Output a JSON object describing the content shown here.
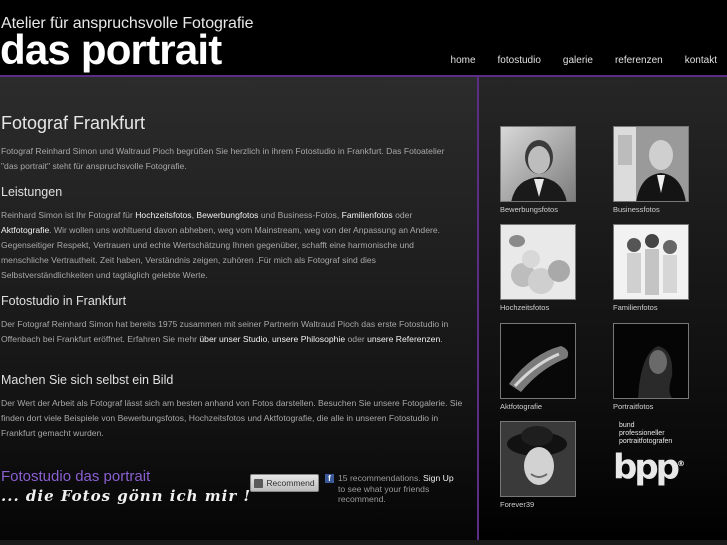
{
  "header": {
    "tagline": "Atelier für anspruchsvolle Fotografie",
    "brand": "das portrait"
  },
  "nav": [
    {
      "label": "home"
    },
    {
      "label": "fotostudio"
    },
    {
      "label": "galerie"
    },
    {
      "label": "referenzen"
    },
    {
      "label": "kontakt"
    }
  ],
  "main": {
    "title": "Fotograf Frankfurt",
    "intro": "Fotograf Reinhard Simon und Waltraud Pioch begrüßen Sie herzlich in ihrem Fotostudio in Frankfurt. Das Fotoatelier \"das portrait\" steht für anspruchsvolle Fotografie.",
    "leistungen_title": "Leistungen",
    "leistungen": {
      "t1": "Reinhard Simon ist Ihr Fotograf für ",
      "l1": "Hochzeitsfotos",
      "t2": ", ",
      "l2": "Bewerbungfotos",
      "t3": " und Business-Fotos, ",
      "l3": "Familienfotos",
      "t4": " oder ",
      "l4": "Aktfotografie",
      "t5": ". Wir wollen uns wohltuend davon abheben, weg vom Mainstream, weg von der Anpassung an Andere. Gegenseitiger Respekt, Vertrauen und echte Wertschätzung Ihnen gegenüber, schafft eine harmonische und menschliche Vertrautheit. Zeit haben, Verständnis zeigen, zuhören .Für mich als Fotograf sind dies Selbstverständlichkeiten und tagtäglich gelebte Werte."
    },
    "studio_title": "Fotostudio in Frankfurt",
    "studio": {
      "t1": "Der Fotograf Reinhard Simon hat bereits 1975 zusammen mit seiner Partnerin Waltraud Pioch das erste Fotostudio in Offenbach bei Frankfurt eröffnet. Erfahren Sie mehr ",
      "l1": "über unser Studio",
      "t2": ", ",
      "l2": "unsere Philosophie",
      "t3": " oder ",
      "l3": "unsere Referenzen",
      "t4": "."
    },
    "bild_title": "Machen Sie sich selbst ein Bild",
    "bild": "Der Wert der Arbeit als Fotograf lässt sich am besten anhand von Fotos darstellen. Besuchen Sie unsere Fotogalerie. Sie finden dort viele Beispiele von Bewerbungsfotos, Hochzeitsfotos und Aktfotografie, die alle in unseren Fotostudio in Frankfurt gemacht wurden.",
    "cta": "Fotostudio das portrait",
    "slogan": "... die Fotos gönn ich mir !"
  },
  "facebook": {
    "button": "Recommend",
    "icon": "f",
    "text1": "15 recommendations. ",
    "signup": "Sign Up",
    "text2": " to see what your friends recommend."
  },
  "gallery": [
    {
      "caption": "Bewerbungsfotos",
      "icon": "portrait-man-icon"
    },
    {
      "caption": "Businessfotos",
      "icon": "business-man-icon"
    },
    {
      "caption": "Hochzeitsfotos",
      "icon": "wedding-icon"
    },
    {
      "caption": "Familienfotos",
      "icon": "family-icon"
    },
    {
      "caption": "Aktfotografie",
      "icon": "nude-icon"
    },
    {
      "caption": "Portraitfotos",
      "icon": "portrait-woman-icon"
    },
    {
      "caption": "Forever39",
      "icon": "hat-woman-icon"
    }
  ],
  "bpp": {
    "line1": "bund",
    "line2": "professioneller",
    "line3": "portraitfotografen",
    "logo": "bpp",
    "mark": "®"
  }
}
